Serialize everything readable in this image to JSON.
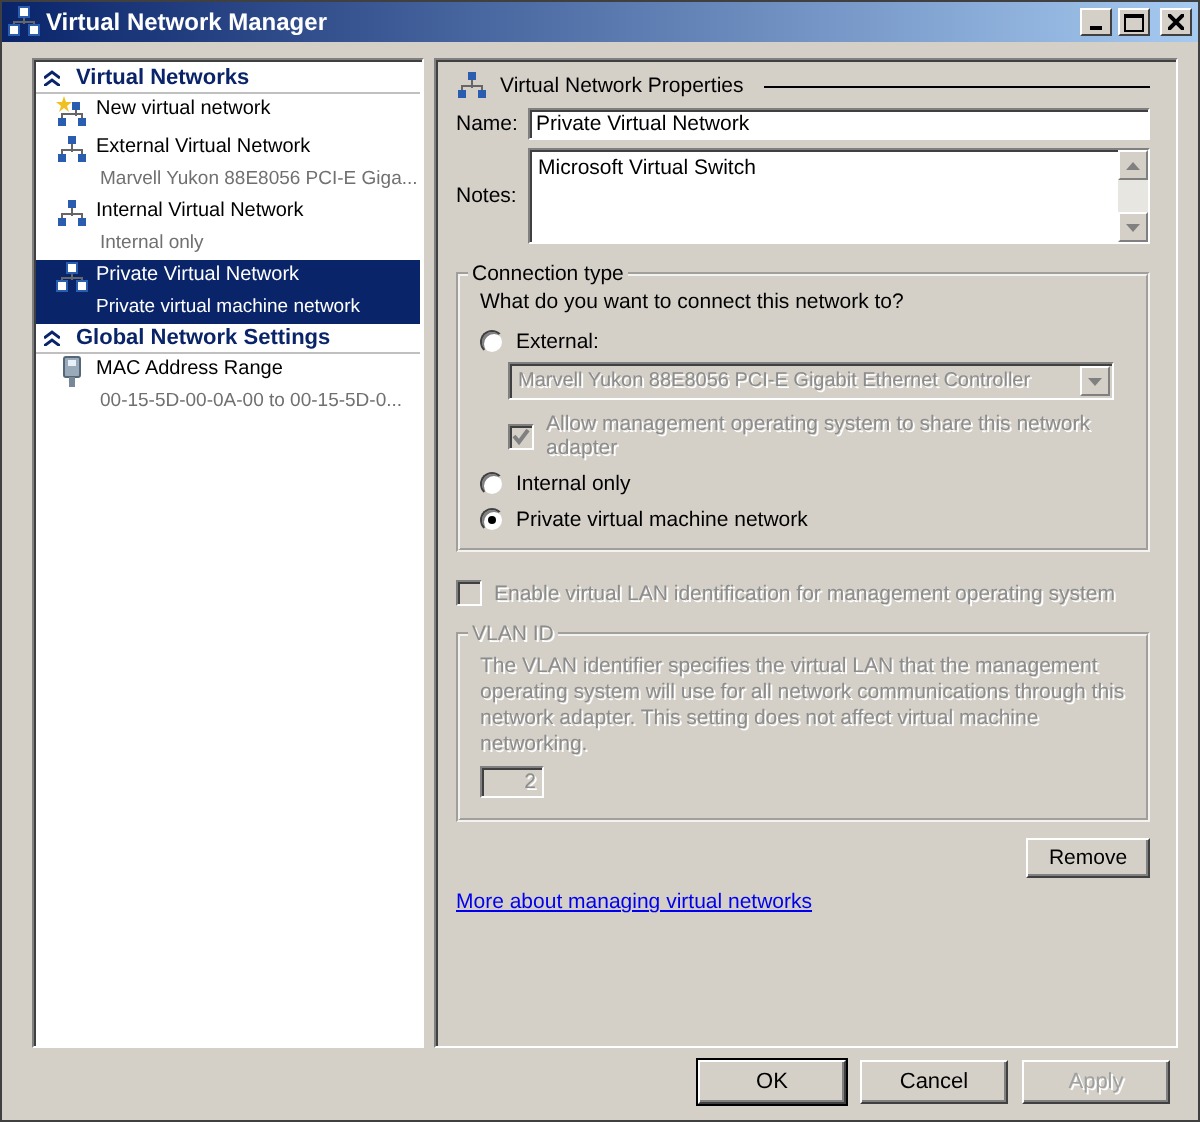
{
  "window": {
    "title": "Virtual Network Manager"
  },
  "sidebar": {
    "sections": [
      {
        "title": "Virtual Networks",
        "expanded": true,
        "items": [
          {
            "kind": "new",
            "label": "New virtual network",
            "selected": false
          },
          {
            "kind": "network",
            "label": "External Virtual Network",
            "detail": "Marvell Yukon 88E8056 PCI-E Giga...",
            "selected": false
          },
          {
            "kind": "network",
            "label": "Internal Virtual Network",
            "detail": "Internal only",
            "selected": false
          },
          {
            "kind": "private",
            "label": "Private Virtual Network",
            "detail": "Private virtual machine network",
            "selected": true
          }
        ]
      },
      {
        "title": "Global Network Settings",
        "expanded": true,
        "items": [
          {
            "kind": "mac",
            "label": "MAC Address Range",
            "detail": "00-15-5D-00-0A-00 to 00-15-5D-0...",
            "selected": false
          }
        ]
      }
    ]
  },
  "properties": {
    "title": "Virtual Network Properties",
    "name_label": "Name:",
    "name_value": "Private Virtual Network",
    "notes_label": "Notes:",
    "notes_value": "Microsoft Virtual Switch",
    "connection": {
      "title": "Connection type",
      "question": "What do you want to connect this network to?",
      "items": [
        {
          "kind": "radio",
          "label": "External:",
          "selected": false
        },
        {
          "kind": "dropdown",
          "value": "Marvell Yukon 88E8056 PCI-E Gigabit Ethernet Controller",
          "disabled": true
        },
        {
          "kind": "checkbox",
          "label": "Allow management operating system to share this network adapter",
          "checked": true,
          "disabled": true
        },
        {
          "kind": "radio",
          "label": "Internal only",
          "selected": false
        },
        {
          "kind": "radio",
          "label": "Private virtual machine network",
          "selected": true
        }
      ]
    },
    "vlan_enable": {
      "label": "Enable virtual LAN identification for management operating system",
      "checked": false,
      "disabled": true
    },
    "vlan": {
      "title": "VLAN ID",
      "description": "The VLAN identifier specifies the virtual LAN that the management operating system will use for all network communications through this network adapter. This setting does not affect virtual machine networking.",
      "value": "2",
      "disabled": true
    },
    "remove_button": "Remove",
    "link": "More about managing virtual networks"
  },
  "buttons": [
    {
      "label": "OK",
      "disabled": false
    },
    {
      "label": "Cancel",
      "disabled": false
    },
    {
      "label": "Apply",
      "disabled": true
    }
  ]
}
